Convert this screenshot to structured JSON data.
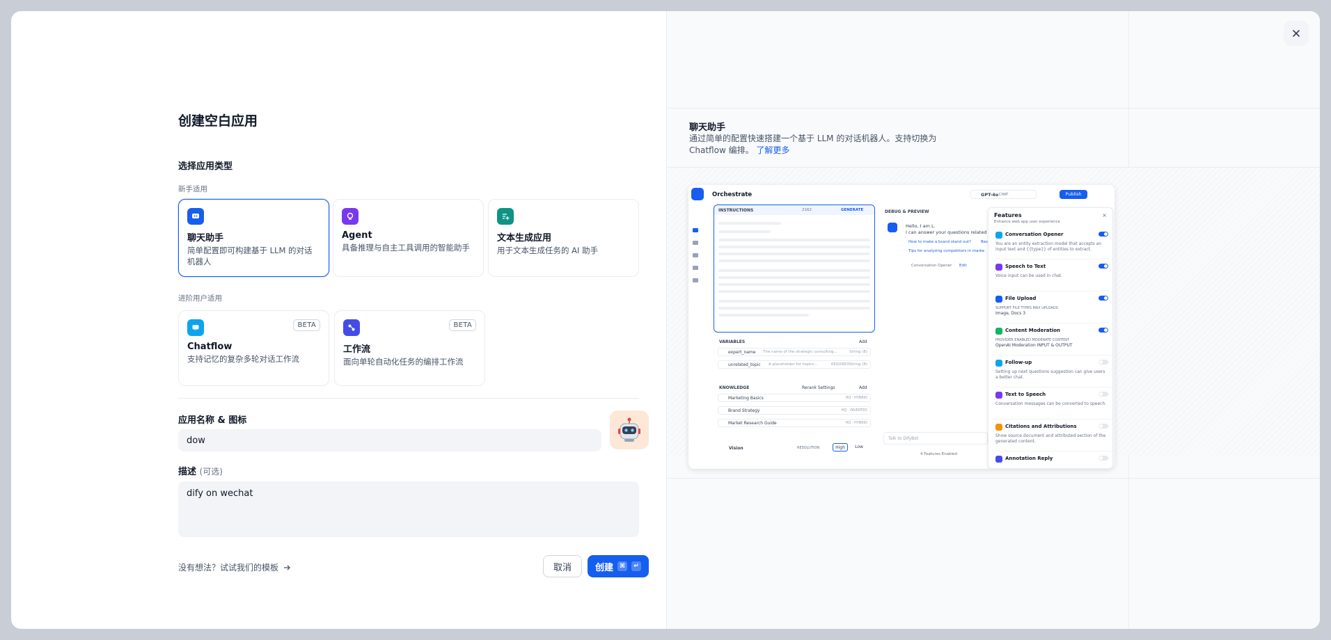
{
  "dialog": {
    "title": "创建空白应用",
    "app_type_label": "选择应用类型",
    "beginner_group": "新手适用",
    "advanced_group": "进阶用户适用",
    "app_types": [
      {
        "name": "聊天助手",
        "desc": "简单配置即可构建基于 LLM 的对话机器人",
        "icon": "chat-bot-icon",
        "color": "#155eef"
      },
      {
        "name": "Agent",
        "desc": "具备推理与自主工具调用的智能助手",
        "icon": "agent-icon",
        "color": "#7839ee"
      },
      {
        "name": "文本生成应用",
        "desc": "用于文本生成任务的 AI 助手",
        "icon": "text-generation-icon",
        "color": "#0e9384"
      },
      {
        "name": "Chatflow",
        "desc": "支持记忆的复杂多轮对话工作流",
        "icon": "chatflow-icon",
        "color": "#0ba5ec",
        "badge": "BETA"
      },
      {
        "name": "工作流",
        "desc": "面向单轮自动化任务的编排工作流",
        "icon": "workflow-icon",
        "color": "#444ce7",
        "badge": "BETA"
      }
    ],
    "name_label": "应用名称 & 图标",
    "name_value": "dow",
    "desc_label": "描述",
    "desc_optional": "(可选)",
    "desc_value": "dify on wechat",
    "template_link": "没有想法？试试我们的模板",
    "cancel_label": "取消",
    "create_label": "创建",
    "create_shortcut_1": "⌘",
    "create_shortcut_2": "↵"
  },
  "preview": {
    "title": "聊天助手",
    "desc": "通过简单的配置快速搭建一个基于 LLM 的对话机器人。支持切换为 Chatflow 编排。",
    "learn_more": "了解更多",
    "screenshot": {
      "header_title": "Orchestrate",
      "model": "GPT-4o",
      "model_tag": "CHAT",
      "publish": "Publish",
      "instructions_label": "INSTRUCTIONS",
      "instructions_count": "2162",
      "generate": "GENERATE",
      "variables_label": "VARIABLES",
      "add": "Add",
      "variables": [
        {
          "name": "expert_name",
          "desc": "The name of the strategic consulting...",
          "type": "String (8)"
        },
        {
          "name": "unrelated_topic",
          "desc": "A placeholder for topics...",
          "required": "REQUIRED",
          "type": "String (8)"
        }
      ],
      "knowledge_label": "KNOWLEDGE",
      "rerank": "Rerank Settings",
      "knowledge": [
        {
          "name": "Marketing Basics",
          "tag": "HQ · HYBRID"
        },
        {
          "name": "Brand Strategy",
          "tag": "HQ · INVERTED"
        },
        {
          "name": "Market Research Guide",
          "tag": "HQ · HYBRID"
        }
      ],
      "vision_label": "Vision",
      "resolution_label": "RESOLUTION",
      "high": "High",
      "low": "Low",
      "debug_label": "DEBUG & PREVIEW",
      "bot_greeting_1": "Hello, I am L.",
      "bot_greeting_2": "I can answer your questions related",
      "suggestion_1": "How to make a brand stand out?",
      "suggestion_1b": "Bes",
      "suggestion_2": "Tips for analyzing competitors in marke",
      "opener_label": "Conversation Opener",
      "opener_edit": "Edit",
      "chat_placeholder": "Talk to DifyBot",
      "features_enabled": "4 Features Enabled",
      "features_title": "Features",
      "features_sub": "Enhance web app user experience",
      "features": [
        {
          "name": "Conversation Opener",
          "desc": "You are an entity extraction model that accepts an input text and {{type}} of entities to extract.",
          "on": true,
          "color": "#0ba5ec"
        },
        {
          "name": "Speech to Text",
          "desc": "Voice input can be used in chat.",
          "on": true,
          "color": "#7839ee"
        },
        {
          "name": "File Upload",
          "desc": "SUPPORT FILE TYPES  MAX UPLOADS",
          "extra": "Image, Docs   3",
          "on": true,
          "color": "#155eef"
        },
        {
          "name": "Content Moderation",
          "desc": "PROVIDER  ENABLED MODERATE CONTENT",
          "extra": "OpenAI Moderation   INPUT & OUTPUT",
          "on": true,
          "color": "#16b364"
        },
        {
          "name": "Follow-up",
          "desc": "Setting up next questions suggestion can give users a better chat.",
          "on": false,
          "color": "#0ba5ec"
        },
        {
          "name": "Text to Speech",
          "desc": "Conversation messages can be converted to speech.",
          "on": false,
          "color": "#7839ee"
        },
        {
          "name": "Citations and Attributions",
          "desc": "Show source document and attributed section of the generated content.",
          "on": false,
          "color": "#f79009"
        },
        {
          "name": "Annotation Reply",
          "desc": "",
          "on": false,
          "color": "#444ce7"
        }
      ]
    }
  },
  "close_icon": "close-icon"
}
